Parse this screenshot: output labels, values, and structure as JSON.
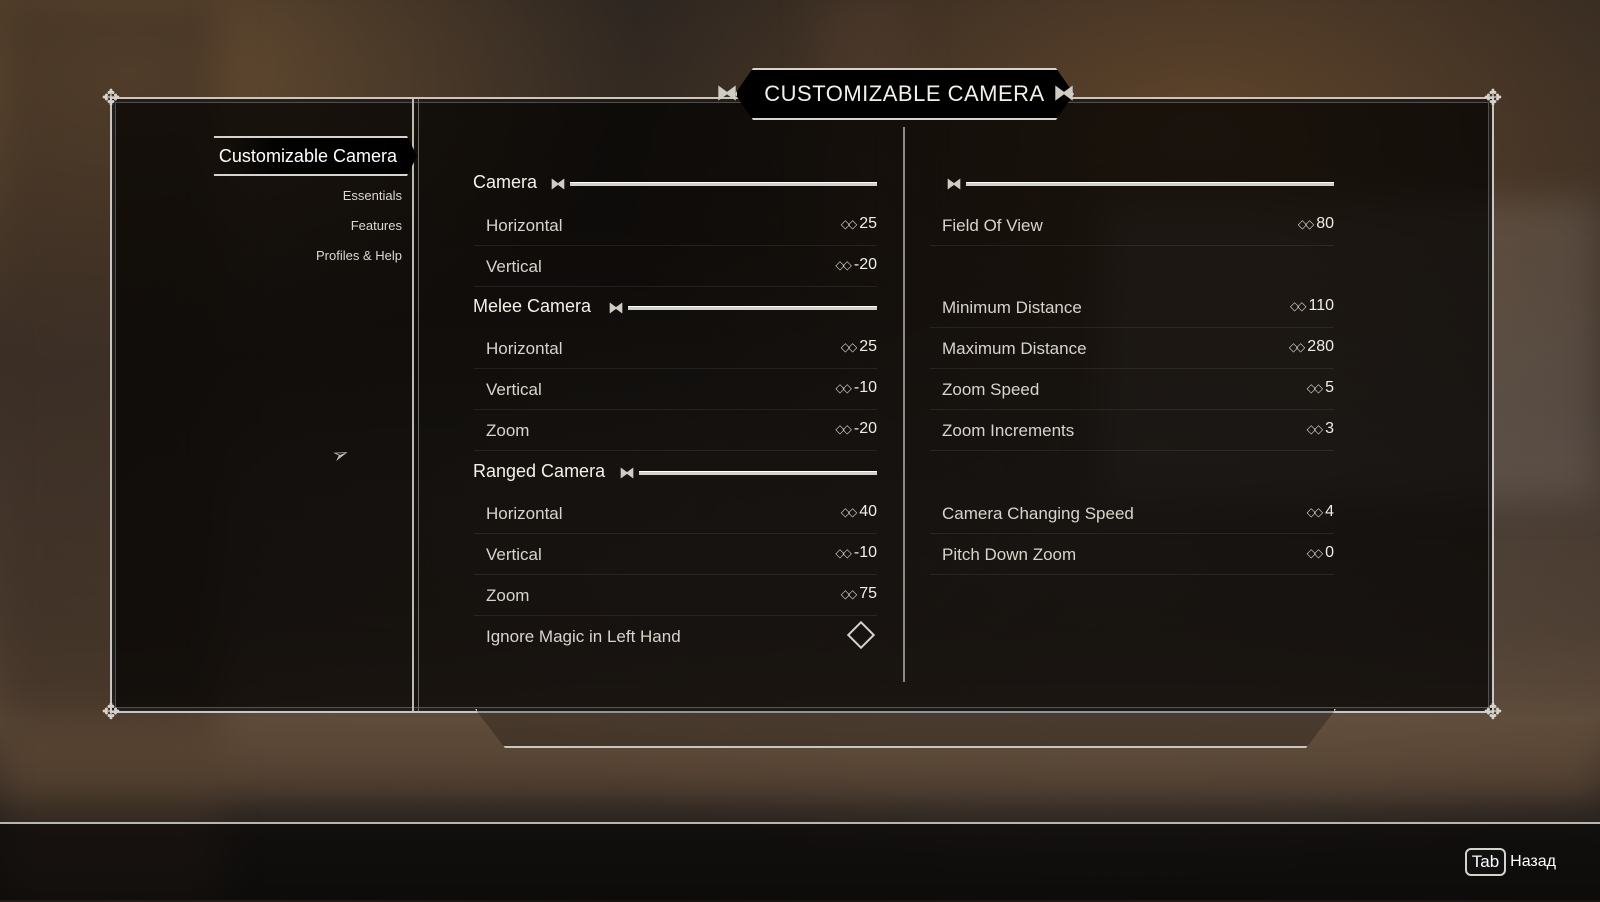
{
  "title": "CUSTOMIZABLE CAMERA",
  "sidebar": {
    "active": "Customizable Camera",
    "items": [
      "Essentials",
      "Features",
      "Profiles & Help"
    ]
  },
  "left_column": {
    "camera": {
      "header": "Camera",
      "rows": [
        {
          "label": "Horizontal",
          "value": "25"
        },
        {
          "label": "Vertical",
          "value": "-20"
        }
      ]
    },
    "melee": {
      "header": "Melee Camera",
      "rows": [
        {
          "label": "Horizontal",
          "value": "25"
        },
        {
          "label": "Vertical",
          "value": "-10"
        },
        {
          "label": "Zoom",
          "value": "-20"
        }
      ]
    },
    "ranged": {
      "header": "Ranged Camera",
      "rows": [
        {
          "label": "Horizontal",
          "value": "40"
        },
        {
          "label": "Vertical",
          "value": "-10"
        },
        {
          "label": "Zoom",
          "value": "75"
        }
      ]
    },
    "ignore_magic": {
      "label": "Ignore Magic in Left Hand",
      "checked": false
    }
  },
  "right_column": {
    "rows": [
      {
        "label": "Field Of View",
        "value": "80"
      },
      {
        "label": "Minimum Distance",
        "value": "110"
      },
      {
        "label": "Maximum Distance",
        "value": "280"
      },
      {
        "label": "Zoom Speed",
        "value": "5"
      },
      {
        "label": "Zoom Increments",
        "value": "3"
      },
      {
        "label": "Camera Changing Speed",
        "value": "4"
      },
      {
        "label": "Pitch Down Zoom",
        "value": "0"
      }
    ]
  },
  "footer": {
    "key": "Tab",
    "label": "Назад"
  },
  "icons": {
    "slider": "slider-arrows-icon",
    "knot": "celtic-knot-icon",
    "cursor": "arrow-cursor-icon"
  },
  "colors": {
    "frame": "#c9c6c0",
    "panel": "#000000",
    "text": "#e8e4dc"
  }
}
